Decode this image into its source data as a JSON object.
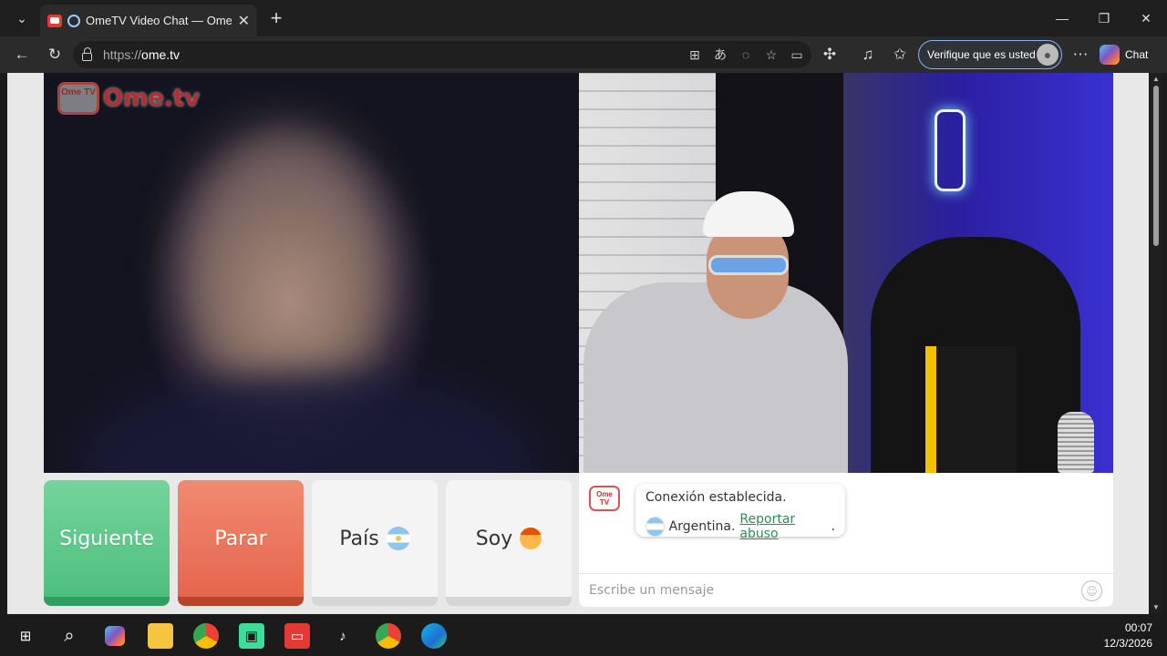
{
  "browser": {
    "tab_title": "OmeTV Video Chat — Omegle",
    "url_prefix": "https://",
    "url_domain": "ome.tv",
    "verify_label": "Verifique que es usted",
    "chat_label": "Chat"
  },
  "site": {
    "logo_text": "Ome.tv",
    "logo_icon_text": "Ome TV"
  },
  "controls": {
    "next_label": "Siguiente",
    "stop_label": "Parar",
    "country_label": "País",
    "gender_label": "Soy"
  },
  "chat": {
    "message_line1": "Conexión establecida.",
    "country": "Argentina.",
    "report_link": "Reportar abuso",
    "period": ".",
    "input_placeholder": "Escribe un mensaje"
  },
  "taskbar": {
    "time": "00:07",
    "date": "12/3/2026",
    "apps": [
      "start-icon",
      "search-icon",
      "copilot-icon",
      "file-explorer-icon",
      "chrome-icon",
      "app-icon",
      "ometv-icon",
      "tiktok-icon",
      "chrome-profile-icon",
      "edge-icon"
    ]
  },
  "colors": {
    "next_green": "#4fbf7e",
    "stop_red": "#e5664c",
    "link_green": "#2e8b57",
    "brand_red": "#e53935"
  }
}
